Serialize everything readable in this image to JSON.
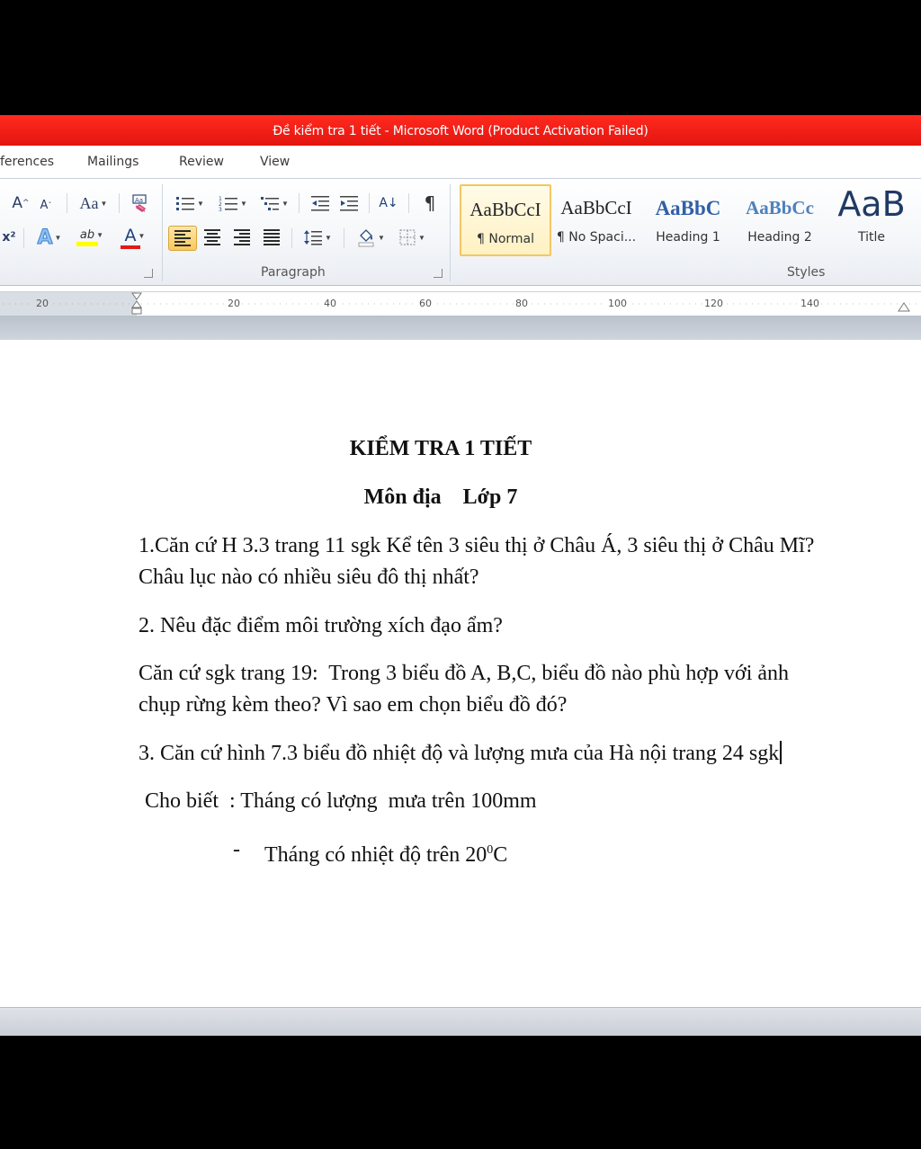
{
  "window": {
    "title": "Đề kiểm tra 1 tiết  -  Microsoft Word (Product Activation Failed)"
  },
  "tabs": [
    "ferences",
    "Mailings",
    "Review",
    "View"
  ],
  "ribbon": {
    "font_row1": {
      "grow": "A",
      "shrink": "A",
      "case": "Aa"
    },
    "font_row2": {
      "superscript": "x²",
      "text_effects": "A",
      "highlight": "ab",
      "font_color": "A"
    },
    "paragraph_label": "Paragraph",
    "styles_label": "Styles",
    "pilcrow": "¶",
    "sort": "A↓",
    "styles": [
      {
        "sample": "AaBbCcI",
        "name": "¶ Normal"
      },
      {
        "sample": "AaBbCcI",
        "name": "¶ No Spaci..."
      },
      {
        "sample": "AaBbC",
        "name": "Heading 1"
      },
      {
        "sample": "AaBbCc",
        "name": "Heading 2"
      },
      {
        "sample": "AaB",
        "name": "Title"
      }
    ],
    "colors": {
      "highlight": "#ffff00",
      "font_color": "#e0191b",
      "heading_blue": "#2f5fa8"
    }
  },
  "ruler": [
    "20",
    "20",
    "40",
    "60",
    "80",
    "100",
    "120",
    "140"
  ],
  "document": {
    "title": "KIỂM TRA 1 TIẾT",
    "subtitle": "Môn địa    Lớp 7",
    "q1_line1": "1.Căn cứ H 3.3 trang 11 sgk Kể tên 3 siêu thị ở Châu Á, 3 siêu thị ở Châu Mĩ?",
    "q1_line2": "Châu lục nào có nhiều siêu đô thị nhất?",
    "q2": "2. Nêu đặc điểm môi trường xích đạo ẩm?",
    "q2b_line1": "Căn cứ sgk trang 19:  Trong 3 biểu đồ A, B,C, biểu đồ nào phù hợp với ảnh",
    "q2b_line2": "chụp rừng kèm theo? Vì sao em chọn biểu đồ đó?",
    "q3": "3. Căn cứ hình 7.3 biểu đồ nhiệt độ và lượng mưa của Hà nội trang 24 sgk",
    "q3_sub1": "Cho biết  : Tháng có lượng  mưa trên 100mm",
    "q3_bullet": "-",
    "q3_sub2_prefix": "Tháng có nhiệt độ trên 20",
    "q3_sub2_sup": "0",
    "q3_sub2_suffix": "C"
  }
}
